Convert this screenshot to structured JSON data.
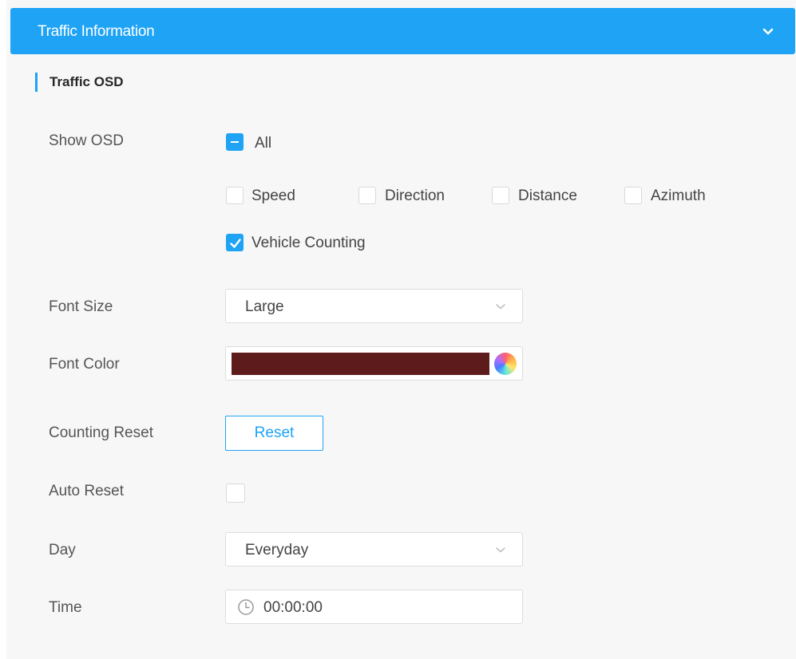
{
  "header": {
    "title": "Traffic Information",
    "chevron_icon": "chevron-down-icon",
    "background_color": "#1ea3f5"
  },
  "section": {
    "title": "Traffic OSD"
  },
  "show_osd": {
    "label": "Show OSD",
    "all": {
      "label": "All",
      "state": "indeterminate"
    },
    "options": [
      {
        "label": "Speed",
        "checked": false
      },
      {
        "label": "Direction",
        "checked": false
      },
      {
        "label": "Distance",
        "checked": false
      },
      {
        "label": "Azimuth",
        "checked": false
      },
      {
        "label": "Vehicle Counting",
        "checked": true
      }
    ]
  },
  "font_size": {
    "label": "Font Size",
    "value": "Large"
  },
  "font_color": {
    "label": "Font Color",
    "value": "#5e1b1b",
    "picker_icon": "color-wheel-icon"
  },
  "counting_reset": {
    "label": "Counting Reset",
    "button_label": "Reset"
  },
  "auto_reset": {
    "label": "Auto Reset",
    "checked": false
  },
  "day": {
    "label": "Day",
    "value": "Everyday"
  },
  "time": {
    "label": "Time",
    "value": "00:00:00",
    "icon": "clock-icon"
  }
}
